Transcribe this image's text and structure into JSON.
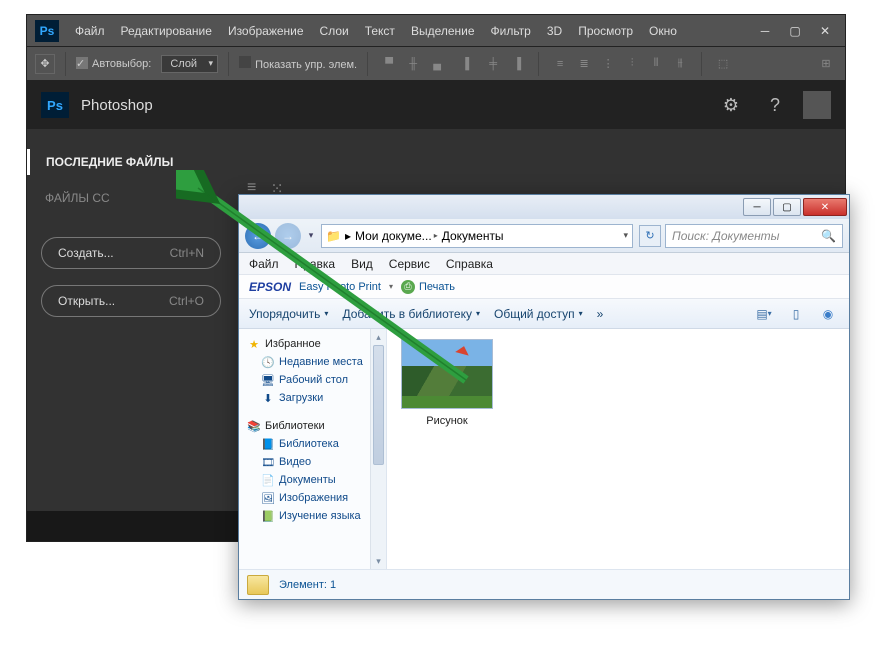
{
  "ps": {
    "menu": [
      "Файл",
      "Редактирование",
      "Изображение",
      "Слои",
      "Текст",
      "Выделение",
      "Фильтр",
      "3D",
      "Просмотр",
      "Окно"
    ],
    "opt": {
      "auto": "Автовыбор:",
      "layer": "Слой",
      "show": "Показать упр. элем."
    },
    "brand": "Photoshop",
    "side": {
      "recent": "ПОСЛЕДНИЕ ФАЙЛЫ",
      "cc": "ФАЙЛЫ CC",
      "create": "Создать...",
      "create_sc": "Ctrl+N",
      "open": "Открыть...",
      "open_sc": "Ctrl+O"
    }
  },
  "ex": {
    "addr": {
      "root": "Мои докуме...",
      "folder": "Документы"
    },
    "search": "Поиск: Документы",
    "menu": [
      "Файл",
      "Правка",
      "Вид",
      "Сервис",
      "Справка"
    ],
    "epson": {
      "brand": "EPSON",
      "link": "Easy Photo Print",
      "print": "Печать"
    },
    "toolbar": {
      "org": "Упорядочить",
      "add": "Добавить в библиотеку",
      "share": "Общий доступ",
      "more": "»"
    },
    "tree": {
      "fav": "Избранное",
      "fav_items": [
        "Недавние места",
        "Рабочий стол",
        "Загрузки"
      ],
      "lib": "Библиотеки",
      "lib_items": [
        "Библиотека",
        "Видео",
        "Документы",
        "Изображения",
        "Изучение языка"
      ]
    },
    "item": "Рисунок",
    "status": "Элемент: 1"
  }
}
